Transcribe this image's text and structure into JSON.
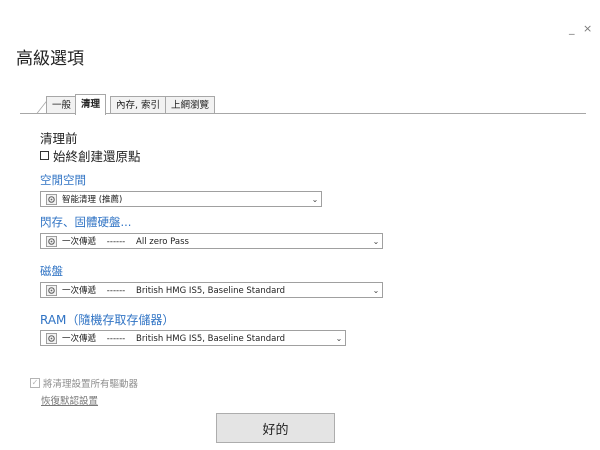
{
  "window": {
    "title": "高級選項",
    "controls": {
      "minimize": "_",
      "close": "×"
    }
  },
  "tabs": [
    {
      "label": "一般",
      "active": false
    },
    {
      "label": "清理",
      "active": true
    },
    {
      "label": "內存, 索引",
      "active": false
    },
    {
      "label": "上網瀏覽",
      "active": false
    }
  ],
  "before_cleanup": {
    "title": "清理前",
    "restore_point_label": "始終創建還原點",
    "restore_point_checked": false
  },
  "sections": [
    {
      "title": "空閒空間",
      "value": "智能清理 (推薦)"
    },
    {
      "title": "閃存、固體硬盤...",
      "value": "一次傳遞    ------    All zero Pass"
    },
    {
      "title": "磁盤",
      "value": "一次傳遞    ------    British HMG IS5, Baseline Standard"
    },
    {
      "title": "RAM（隨機存取存儲器）",
      "value": "一次傳遞    ------    British HMG IS5, Baseline Standard"
    }
  ],
  "apply_all": {
    "label": "將清理設置所有驅動器",
    "checked": true
  },
  "restore_defaults": "恢復默認設置",
  "ok_button": "好的",
  "icons": {
    "select_option": "gear-icon",
    "dropdown": "chevron-down-icon"
  }
}
